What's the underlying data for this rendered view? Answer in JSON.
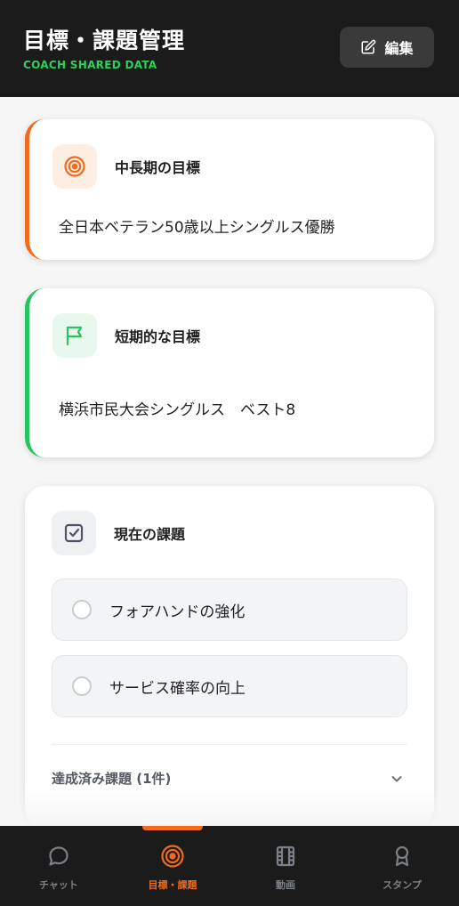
{
  "header": {
    "title": "目標・課題管理",
    "subtitle": "COACH SHARED DATA",
    "edit_label": "編集"
  },
  "goals": {
    "long_term": {
      "label": "中長期の目標",
      "text": "全日本ベテラン50歳以上シングルス優勝",
      "icon": "target-icon",
      "accent": "#f26a1b"
    },
    "short_term": {
      "label": "短期的な目標",
      "text": "横浜市民大会シングルス　ベスト8",
      "icon": "flag-icon",
      "accent": "#22c55e"
    }
  },
  "tasks": {
    "label": "現在の課題",
    "icon": "checkbox-icon",
    "items": [
      {
        "label": "フォアハンドの強化",
        "done": false
      },
      {
        "label": "サービス確率の向上",
        "done": false
      }
    ],
    "completed_label": "達成済み課題 (1件)"
  },
  "nav": {
    "items": [
      {
        "label": "チャット",
        "icon": "chat-icon",
        "active": false
      },
      {
        "label": "目標・課題",
        "icon": "target-icon",
        "active": true
      },
      {
        "label": "動画",
        "icon": "film-icon",
        "active": false
      },
      {
        "label": "スタンプ",
        "icon": "award-icon",
        "active": false
      }
    ]
  },
  "colors": {
    "accent_orange": "#f26a1b",
    "accent_green": "#22c55e",
    "header_bg": "#1b1b1b"
  }
}
